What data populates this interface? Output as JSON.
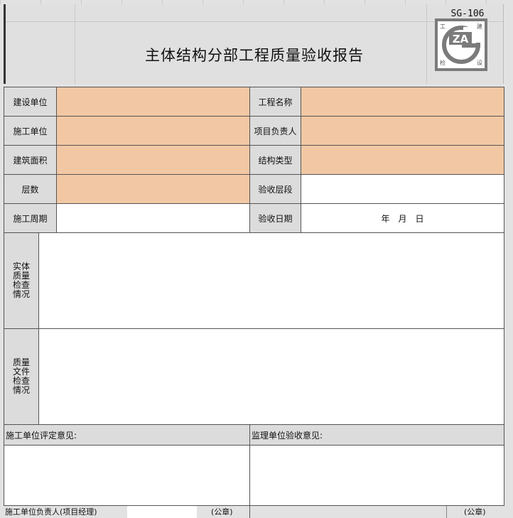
{
  "form": {
    "code": "SG-106",
    "title": "主体结构分部工程质量验收报告",
    "logo": {
      "text": "ZA",
      "corner_chars": [
        "工",
        "建",
        "检",
        "设"
      ]
    },
    "fields": {
      "construction_unit": "建设单位",
      "project_name": "工程名称",
      "builder_unit": "施工单位",
      "project_manager": "项目负责人",
      "building_area": "建筑面积",
      "structure_type": "结构类型",
      "floors": "层数",
      "acceptance_floor": "验收层段",
      "construction_period": "施工周期",
      "acceptance_date": "验收日期",
      "date_value": "年　月　日"
    },
    "sections": {
      "entity_check": "实体质量检查情况",
      "document_check": "质量文件检查情况"
    },
    "opinions": {
      "builder_opinion": "施工单位评定意见:",
      "supervisor_opinion": "监理单位验收意见:"
    },
    "bottom": {
      "left_partial": "施工单位负责人(项目经理)",
      "seal_left": "(公章)",
      "seal_right": "(公章)"
    }
  },
  "colors": {
    "fill": "#f2c8a4",
    "label_bg": "#dcdcdc",
    "border": "#555555"
  }
}
